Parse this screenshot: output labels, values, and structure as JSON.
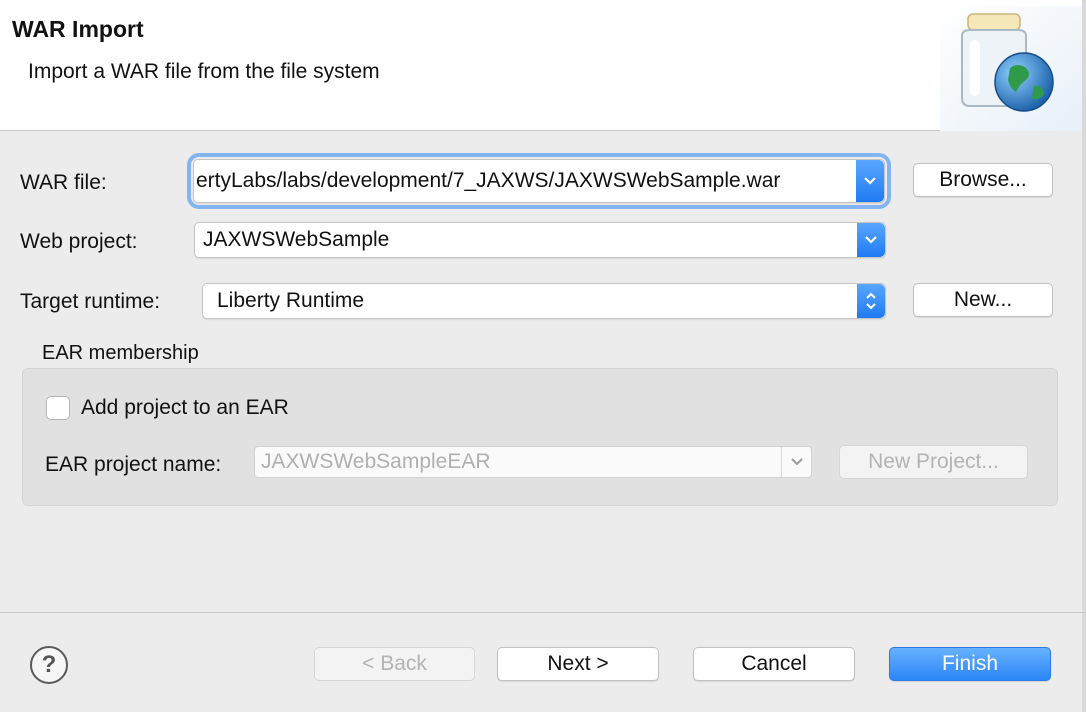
{
  "header": {
    "title": "WAR Import",
    "description": "Import a WAR file from the file system",
    "banner_icon": "war-jar-globe-icon"
  },
  "form": {
    "war_file_label": "WAR file:",
    "war_file_value": "ertyLabs/labs/development/7_JAXWS/JAXWSWebSample.war",
    "browse_label": "Browse...",
    "web_project_label": "Web project:",
    "web_project_value": "JAXWSWebSample",
    "target_runtime_label": "Target runtime:",
    "target_runtime_value": "Liberty Runtime",
    "new_label": "New..."
  },
  "ear": {
    "group_label": "EAR membership",
    "add_checkbox_label": "Add project to an EAR",
    "add_checked": false,
    "project_name_label": "EAR project name:",
    "project_name_value": "JAXWSWebSampleEAR",
    "new_project_label": "New Project..."
  },
  "footer": {
    "help_glyph": "?",
    "back_label": "< Back",
    "next_label": "Next >",
    "cancel_label": "Cancel",
    "finish_label": "Finish"
  },
  "colors": {
    "accent": "#2c86f7",
    "background": "#ececec",
    "header_background": "#ffffff"
  }
}
